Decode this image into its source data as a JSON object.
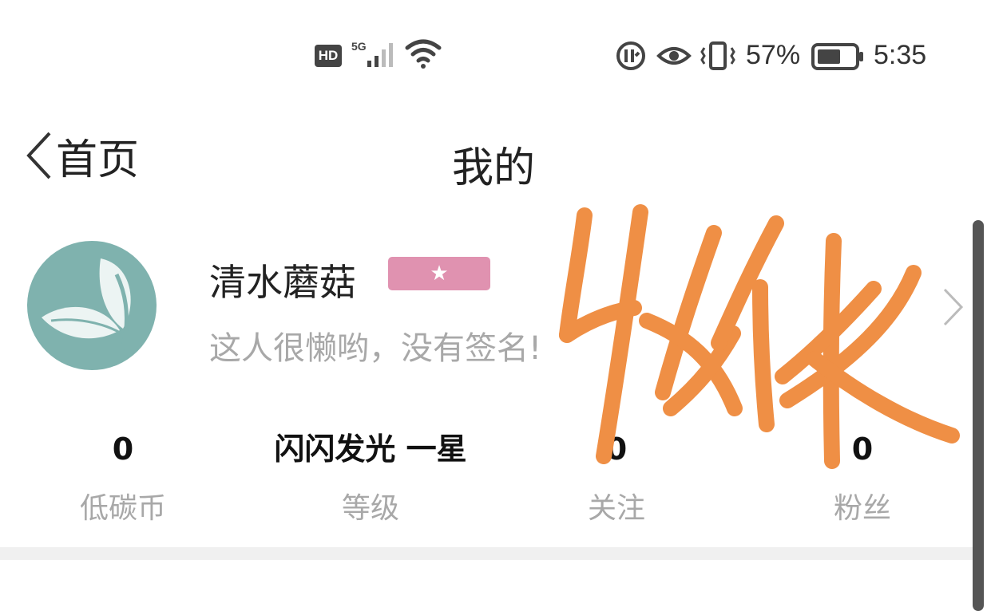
{
  "status_bar": {
    "hd": "HD",
    "network": "5G",
    "battery_percent": "57%",
    "time": "5:35",
    "icons": [
      "hd-icon",
      "signal-icon",
      "wifi-icon",
      "data-saver-icon",
      "eye-icon",
      "vibrate-icon",
      "battery-icon"
    ]
  },
  "header": {
    "back_label": "首页",
    "title": "我的"
  },
  "profile": {
    "name": "清水蘑菇",
    "badge_icon": "★",
    "signature": "这人很懒哟，没有签名!"
  },
  "stats": [
    {
      "value": "0",
      "label": "低碳币"
    },
    {
      "value": "闪闪发光 一星",
      "label": "等级"
    },
    {
      "value": "0",
      "label": "关注"
    },
    {
      "value": "0",
      "label": "粉丝"
    }
  ],
  "colors": {
    "avatar_bg": "#7fb2ae",
    "badge_bg": "#e092b0",
    "watermark": "#ef8f45",
    "muted_text": "#a8a8a8"
  }
}
